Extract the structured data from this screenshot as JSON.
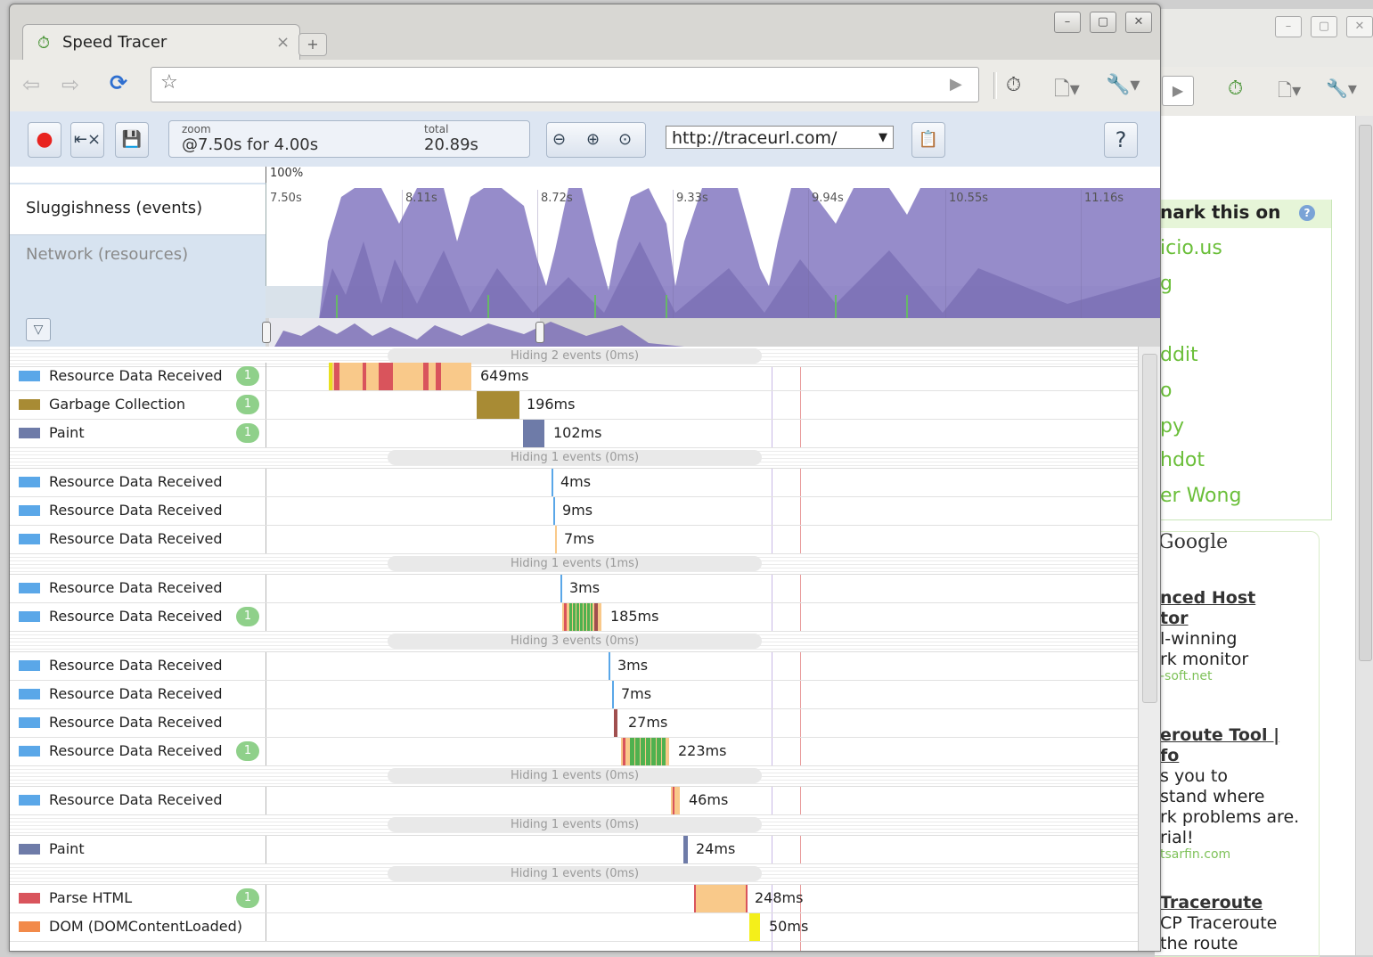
{
  "window": {
    "tab_title": "Speed Tracer",
    "tab_close": "×",
    "new_tab": "+",
    "min": "–",
    "max": "▢",
    "close": "✕"
  },
  "navbar": {
    "omnibox_value": "",
    "star": "☆",
    "go": "▶"
  },
  "toolbar": {
    "zoom_label": "zoom",
    "zoom_value": "@7.50s for 4.00s",
    "total_label": "total",
    "total_value": "20.89s",
    "url": "http://traceurl.com/",
    "help": "?"
  },
  "overview": {
    "percent": "100%",
    "sluggishness_label": "Sluggishness (events)",
    "network_label": "Network (resources)",
    "ticks": [
      "7.50s",
      "8.11s",
      "8.72s",
      "9.33s",
      "9.94s",
      "10.55s",
      "11.16s"
    ]
  },
  "events": [
    {
      "type": "hide",
      "text": "Hiding 2 events (0ms)"
    },
    {
      "type": "row",
      "label": "Resource Data Received",
      "color": "#5aa7e8",
      "badge": "1",
      "duration": "649ms"
    },
    {
      "type": "row",
      "label": "Garbage Collection",
      "color": "#a88b34",
      "badge": "1",
      "duration": "196ms"
    },
    {
      "type": "row",
      "label": "Paint",
      "color": "#6e7ba8",
      "badge": "1",
      "duration": "102ms"
    },
    {
      "type": "hide",
      "text": "Hiding 1 events (0ms)"
    },
    {
      "type": "row",
      "label": "Resource Data Received",
      "color": "#5aa7e8",
      "badge": "",
      "duration": "4ms"
    },
    {
      "type": "row",
      "label": "Resource Data Received",
      "color": "#5aa7e8",
      "badge": "",
      "duration": "9ms"
    },
    {
      "type": "row",
      "label": "Resource Data Received",
      "color": "#5aa7e8",
      "badge": "",
      "duration": "7ms"
    },
    {
      "type": "hide",
      "text": "Hiding 1 events (1ms)"
    },
    {
      "type": "row",
      "label": "Resource Data Received",
      "color": "#5aa7e8",
      "badge": "",
      "duration": "3ms"
    },
    {
      "type": "row",
      "label": "Resource Data Received",
      "color": "#5aa7e8",
      "badge": "1",
      "duration": "185ms"
    },
    {
      "type": "hide",
      "text": "Hiding 3 events (0ms)"
    },
    {
      "type": "row",
      "label": "Resource Data Received",
      "color": "#5aa7e8",
      "badge": "",
      "duration": "3ms"
    },
    {
      "type": "row",
      "label": "Resource Data Received",
      "color": "#5aa7e8",
      "badge": "",
      "duration": "7ms"
    },
    {
      "type": "row",
      "label": "Resource Data Received",
      "color": "#5aa7e8",
      "badge": "",
      "duration": "27ms"
    },
    {
      "type": "row",
      "label": "Resource Data Received",
      "color": "#5aa7e8",
      "badge": "1",
      "duration": "223ms"
    },
    {
      "type": "hide",
      "text": "Hiding 1 events (0ms)"
    },
    {
      "type": "row",
      "label": "Resource Data Received",
      "color": "#5aa7e8",
      "badge": "",
      "duration": "46ms"
    },
    {
      "type": "hide",
      "text": "Hiding 1 events (0ms)"
    },
    {
      "type": "row",
      "label": "Paint",
      "color": "#6e7ba8",
      "badge": "",
      "duration": "24ms"
    },
    {
      "type": "hide",
      "text": "Hiding 1 events (0ms)"
    },
    {
      "type": "row",
      "label": "Parse HTML",
      "color": "#d9545c",
      "badge": "1",
      "duration": "248ms"
    },
    {
      "type": "row",
      "label": "DOM (DOMContentLoaded)",
      "color": "#f28a4a",
      "badge": "",
      "duration": "50ms"
    }
  ],
  "background_page": {
    "bookmark_title": "nark this on",
    "bookmark_links": [
      "icio.us",
      "g",
      "ddit",
      "o",
      "py",
      "hdot",
      "er Wong"
    ],
    "google_label": "Google",
    "ads": [
      {
        "title1": "nced Host",
        "title2": "tor",
        "d1": "l-winning",
        "d2": "rk monitor",
        "url": "-soft.net"
      },
      {
        "title1": "eroute Tool |",
        "title2": "fo",
        "d1": "s you to",
        "d2": "stand where",
        "d3": "rk problems are.",
        "d4": "rial!",
        "url": "tsarfin.com"
      },
      {
        "title1": "Traceroute",
        "d1": "CP Traceroute",
        "d2": " the route"
      }
    ]
  },
  "colors": {
    "accent_purple": "#8b7fc4",
    "record_red": "#e8231f",
    "badge_green": "#8fd08a"
  }
}
